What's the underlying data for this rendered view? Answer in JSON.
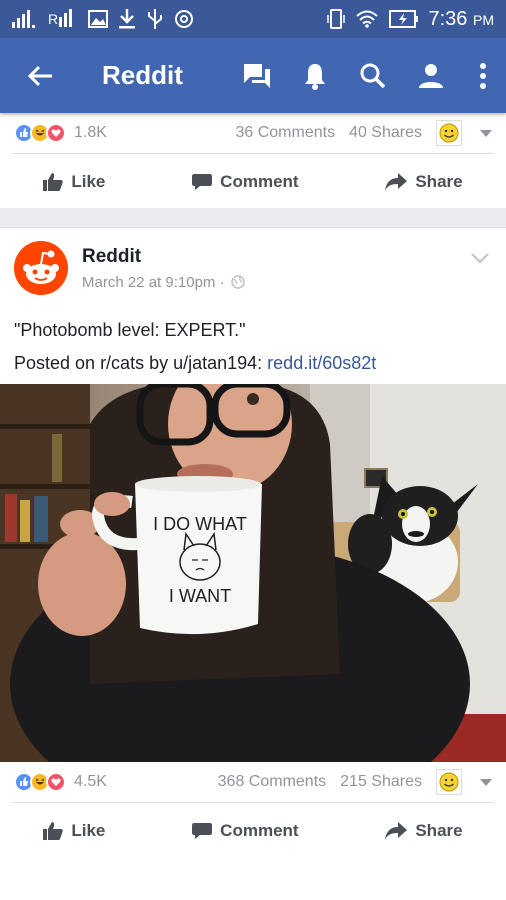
{
  "status_bar": {
    "time": "7:36",
    "ampm": "PM"
  },
  "appbar": {
    "title": "Reddit",
    "icons": [
      "back-arrow-icon",
      "messenger-icon",
      "bell-icon",
      "search-icon",
      "profile-icon",
      "more-icon"
    ]
  },
  "colors": {
    "statusbar": "#3b5998",
    "appbar": "#4267b2",
    "link": "#365899",
    "reddit": "#ff4500"
  },
  "prev_post": {
    "reaction_count": "1.8K",
    "comments": "36 Comments",
    "shares": "40 Shares",
    "actions": {
      "like": "Like",
      "comment": "Comment",
      "share": "Share"
    }
  },
  "post": {
    "author": "Reddit",
    "time": "March 22 at 9:10pm ·",
    "line1": "\"Photobomb level: EXPERT.\"",
    "line2_prefix": "Posted on r/cats by u/jatan194: ",
    "link": "redd.it/60s82t",
    "mug_text_top": "I DO WHAT",
    "mug_text_bottom": "I WANT",
    "reaction_count": "4.5K",
    "comments": "368 Comments",
    "shares": "215 Shares",
    "actions": {
      "like": "Like",
      "comment": "Comment",
      "share": "Share"
    }
  }
}
